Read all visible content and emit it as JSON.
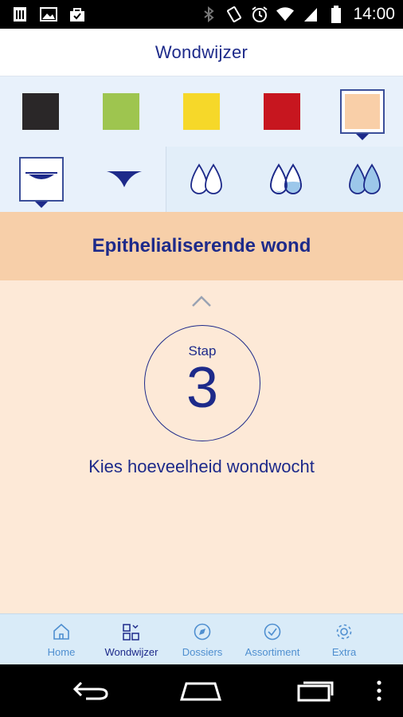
{
  "status_bar": {
    "time": "14:00",
    "left_icons": [
      "sim-icon",
      "image-icon",
      "shopping-bag-icon"
    ],
    "right_icons": [
      "bluetooth-icon",
      "vibrate-icon",
      "alarm-icon",
      "wifi-icon",
      "signal-icon",
      "battery-icon"
    ]
  },
  "app_bar": {
    "title": "Wondwijzer"
  },
  "wound_colors": [
    {
      "name": "black",
      "hex": "#2a2728",
      "selected": false
    },
    {
      "name": "green",
      "hex": "#9ec54f",
      "selected": false
    },
    {
      "name": "yellow",
      "hex": "#f6d829",
      "selected": false
    },
    {
      "name": "red",
      "hex": "#c7161f",
      "selected": false
    },
    {
      "name": "pink",
      "hex": "#f9cfa8",
      "selected": true
    }
  ],
  "wound_depth": [
    {
      "icon": "shallow-wound-icon",
      "selected": true
    },
    {
      "icon": "deep-wound-icon",
      "selected": false
    }
  ],
  "exudate_levels": [
    {
      "icon": "exudate-low-icon",
      "level": 1
    },
    {
      "icon": "exudate-medium-icon",
      "level": 2
    },
    {
      "icon": "exudate-high-icon",
      "level": 3
    }
  ],
  "banner": {
    "title": "Epithelialiserende wond"
  },
  "step": {
    "label": "Stap",
    "number": "3",
    "instruction": "Kies hoeveelheid wondwocht"
  },
  "tabs": [
    {
      "label": "Home",
      "icon": "home-icon",
      "active": false
    },
    {
      "label": "Wondwijzer",
      "icon": "grid-icon",
      "active": true
    },
    {
      "label": "Dossiers",
      "icon": "compass-icon",
      "active": false
    },
    {
      "label": "Assortiment",
      "icon": "check-circle-icon",
      "active": false
    },
    {
      "label": "Extra",
      "icon": "gear-icon",
      "active": false
    }
  ],
  "colors": {
    "primary": "#1d2a8a",
    "tab_inactive": "#4f8fd0",
    "banner": "#f7cfa9",
    "background": "#fde9d7"
  }
}
